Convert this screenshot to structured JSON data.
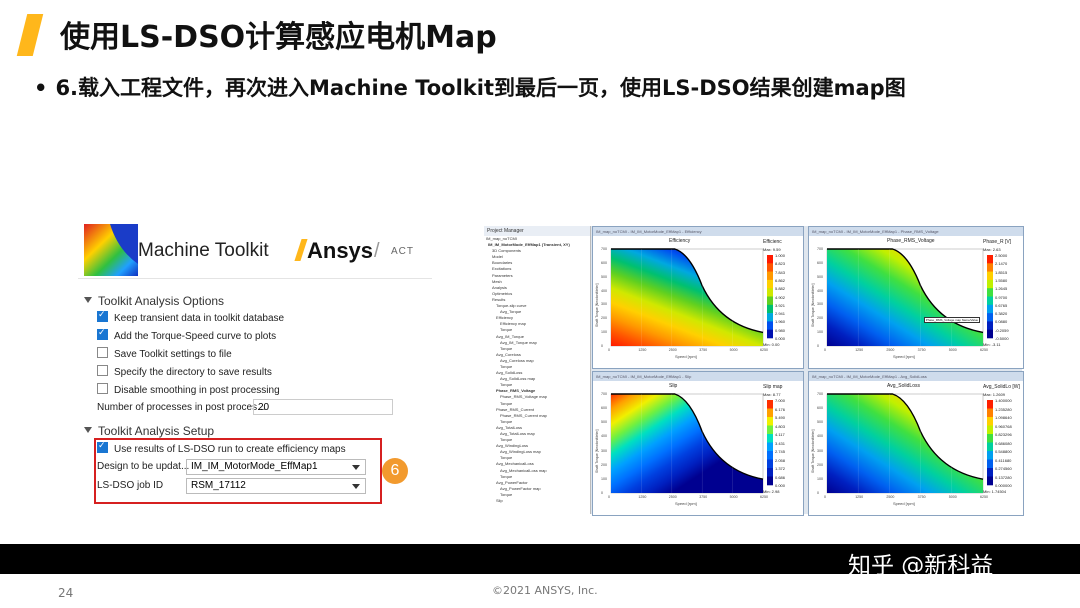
{
  "slide": {
    "title": "使用LS-DSO计算感应电机Map",
    "bullet": "6.载入工程文件，再次进入Machine Toolkit到最后一页，使用LS-DSO结果创建map图",
    "page_number": "24",
    "copyright": "©2021 ANSYS, Inc.",
    "watermark": "知乎 @新科益",
    "accent_color": "#ffb71b"
  },
  "toolkit": {
    "app_title": "Machine Toolkit",
    "logo_text": "Ansys",
    "logo_suffix": "ACT",
    "section1": "Toolkit Analysis Options",
    "options": [
      {
        "label": "Keep transient data in toolkit database",
        "checked": true
      },
      {
        "label": "Add the Torque-Speed curve to plots",
        "checked": true
      },
      {
        "label": "Save Toolkit settings to file",
        "checked": false
      },
      {
        "label": "Specify the directory to save results",
        "checked": false
      },
      {
        "label": "Disable smoothing in post processing",
        "checked": false
      }
    ],
    "processes_label": "Number of processes in post proces...",
    "processes_value": "20",
    "section2": "Toolkit Analysis Setup",
    "use_dso_label": "Use results of LS-DSO run to create efficiency maps",
    "use_dso_checked": true,
    "design_label": "Design to be updat...",
    "design_value": "IM_IM_MotorMode_EffMap1",
    "job_label": "LS-DSO job ID",
    "job_value": "RSM_17112",
    "step_badge": "6",
    "highlight_color": "#d62020"
  },
  "aedt": {
    "project_manager_title": "Project Manager",
    "tree": [
      "IM_map_noTCMI",
      "IM_IM_MotorMode_EffMap1 (Transient, XY)",
      "3D Components",
      "Model",
      "Boundaries",
      "Excitations",
      "Parameters",
      "Mesh",
      "Analysis",
      "Optimetrics",
      "Results",
      "Torque-slip curve",
      "Avg_Torque",
      "Efficiency",
      "Efficiency map",
      "Torque",
      "Avg_IM_Torque",
      "Avg_IM_Torque map",
      "Torque",
      "Avg_Coreloss",
      "Avg_Coreloss map",
      "Torque",
      "Avg_SolidLoss",
      "Avg_SolidLoss map",
      "Torque",
      "Phase_RMS_Voltage",
      "Phase_RMS_Voltage map",
      "Torque",
      "Phase_RMS_Current",
      "Phase_RMS_Current map",
      "Torque",
      "Avg_TotalLoss",
      "Avg_TotalLoss map",
      "Torque",
      "Avg_WindingLoss",
      "Avg_WindingLoss map",
      "Torque",
      "Avg_MechanicalLoss",
      "Avg_MechanicalLoss map",
      "Torque",
      "Avg_PowerFactor",
      "Avg_PowerFactor map",
      "Torque",
      "Slip"
    ],
    "plots": [
      {
        "window_title": "IM_map_noTCMI - IM_IM_MotorMode_EffMap1 - Efficiency",
        "name": "Efficiency",
        "legend_title": "Efficienc",
        "max_label": "Max: 9.59",
        "min_label": "Min: 0.00",
        "scale": [
          "1.000",
          "8.823",
          "7.843",
          "6.862",
          "5.882",
          "4.902",
          "3.921",
          "2.941",
          "1.960",
          "0.980",
          "0.000"
        ],
        "palette": "hot"
      },
      {
        "window_title": "IM_map_noTCMI - IM_IM_MotorMode_EffMap1 - Phase_RMS_Voltage",
        "name": "Phase_RMS_Voltage",
        "legend_title": "Phase_R [V]",
        "max_label": "Max: 2.63",
        "min_label": "Min: -3.11",
        "scale": [
          "2.5000",
          "2.1470",
          "1.8515",
          "1.5580",
          "1.2645",
          "0.9700",
          "0.6765",
          "0.3820",
          "0.0880",
          "-0.2059",
          "-0.5000"
        ],
        "palette": "rainbow",
        "annotation": "Phase_RMS_Voltage map Name/Value"
      },
      {
        "window_title": "IM_map_noTCMI - IM_IM_MotorMode_EffMap1 - Slip",
        "name": "Slip",
        "legend_title": "Slip map",
        "max_label": "Max: 8.77",
        "min_label": "Min: 2.98",
        "scale": [
          "7.000",
          "6.176",
          "5.490",
          "4.803",
          "4.117",
          "3.431",
          "2.745",
          "2.058",
          "1.372",
          "0.686",
          "0.000"
        ],
        "palette": "cold"
      },
      {
        "window_title": "IM_map_noTCMI - IM_IM_MotorMode_EffMap1 - Avg_SolidLoss",
        "name": "Avg_SolidLoss",
        "legend_title": "Avg_SolidLo [W]",
        "max_label": "Max: 1.2609",
        "min_label": "Min: 1.74504",
        "scale": [
          "1.400000",
          "1.235280",
          "1.098640",
          "0.960768",
          "0.823296",
          "0.686080",
          "0.548800",
          "0.411680",
          "0.274560",
          "0.137280",
          "0.000000"
        ],
        "palette": "rainbow"
      }
    ],
    "x_axis_title": "Speed [rpm]",
    "y_axis_title": "Shaft Torque [NewtonMeter]",
    "x_ticks": [
      "0",
      "1250",
      "2500",
      "3750",
      "5000",
      "6250"
    ],
    "y_ticks": [
      "700",
      "600",
      "500",
      "400",
      "300",
      "200",
      "100",
      "0"
    ]
  }
}
